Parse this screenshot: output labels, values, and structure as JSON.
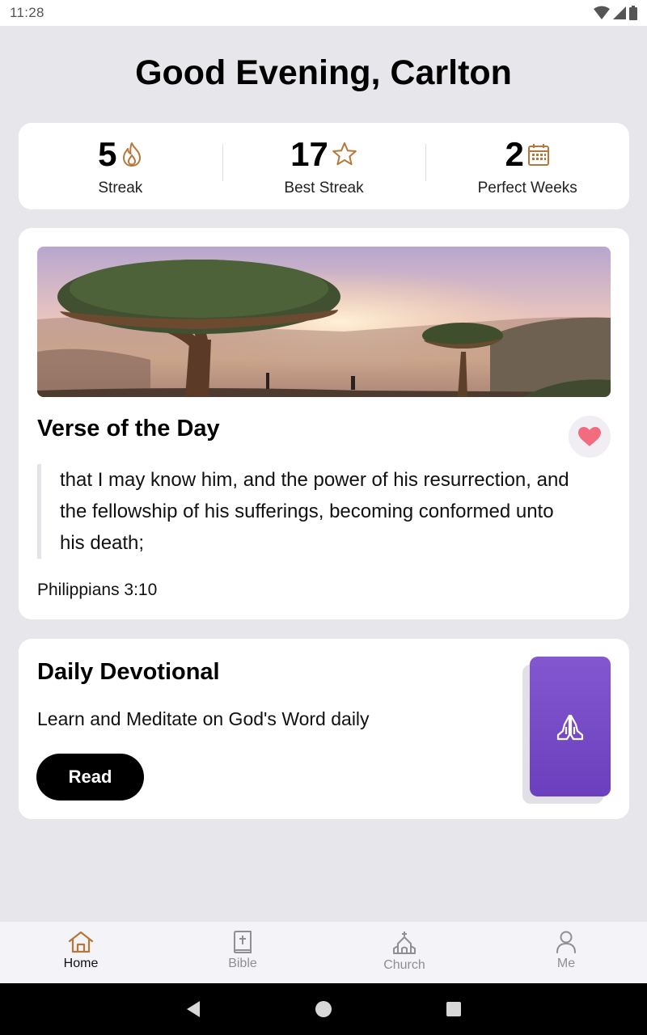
{
  "status_bar": {
    "time": "11:28"
  },
  "greeting": "Good Evening, Carlton",
  "stats": [
    {
      "value": "5",
      "label": "Streak",
      "icon": "flame-icon"
    },
    {
      "value": "17",
      "label": "Best Streak",
      "icon": "star-icon"
    },
    {
      "value": "2",
      "label": "Perfect Weeks",
      "icon": "calendar-icon"
    }
  ],
  "verse": {
    "title": "Verse of the Day",
    "text": "that I may know him, and the power of his resurrection, and the fellowship of his sufferings, becoming conformed unto his death;",
    "reference": "Philippians 3:10",
    "favorite_icon": "heart-icon"
  },
  "devotional": {
    "title": "Daily Devotional",
    "subtitle": "Learn and Meditate on God's Word daily",
    "button_label": "Read",
    "icon": "praying-hands-icon"
  },
  "tabs": [
    {
      "label": "Home",
      "icon": "home-icon",
      "active": true
    },
    {
      "label": "Bible",
      "icon": "bible-icon",
      "active": false
    },
    {
      "label": "Church",
      "icon": "church-icon",
      "active": false
    },
    {
      "label": "Me",
      "icon": "person-icon",
      "active": false
    }
  ],
  "colors": {
    "accent": "#b5773a",
    "heart": "#f26b7e",
    "devotional_purple": "#7a4cc9",
    "background": "#e6e6eb"
  }
}
